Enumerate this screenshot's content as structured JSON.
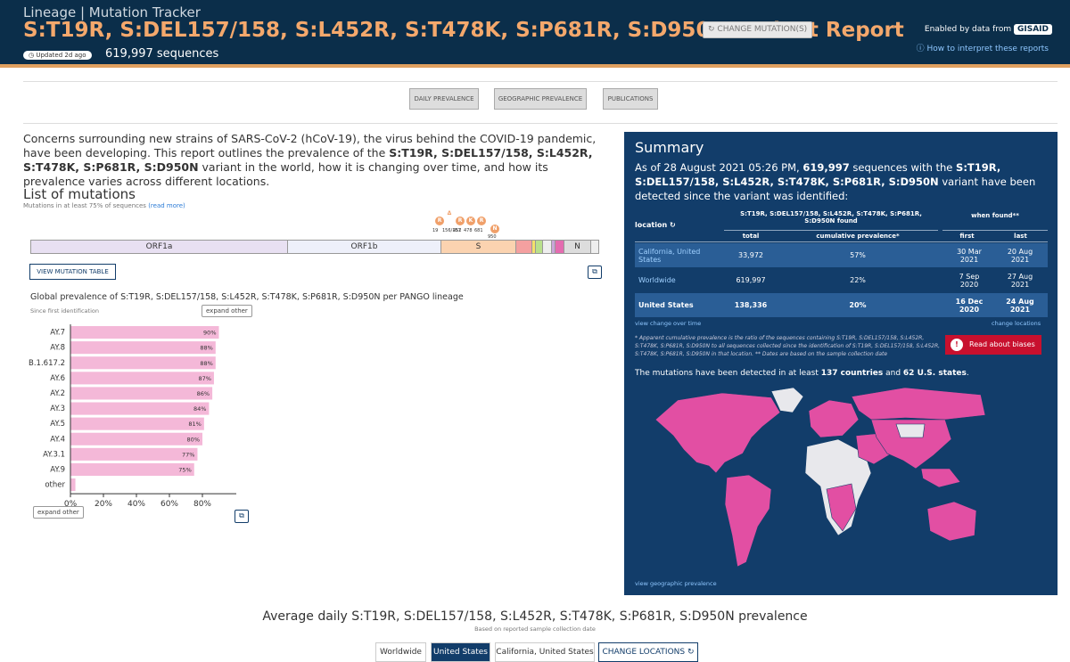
{
  "header": {
    "crumb": "Lineage | Mutation Tracker",
    "title": "S:T19R, S:DEL157/158, S:L452R, S:T478K, S:P681R, S:D950N Variant Report",
    "change_btn": "CHANGE MUTATION(S)",
    "updated": "Updated 2d ago",
    "sequences": "619,997 sequences",
    "enabled_by": "Enabled by data from",
    "gisaid": "GISAID",
    "howto": "How to interpret these reports"
  },
  "tabs": [
    "DAILY PREVALENCE",
    "GEOGRAPHIC PREVALENCE",
    "PUBLICATIONS"
  ],
  "intro": {
    "p1": "Concerns surrounding new strains of SARS-CoV-2 (hCoV-19), the virus behind the COVID-19 pandemic, have been developing. This report outlines the prevalence of the ",
    "bold": "S:T19R, S:DEL157/158, S:L452R, S:T478K, S:P681R, S:D950N",
    "p2": " variant in the world, how it is changing over time, and how its prevalence varies across different locations."
  },
  "mutations_section": {
    "title": "List of mutations",
    "subtitle": "Mutations in at least 75% of sequences ",
    "read_more": "(read more)",
    "view_table": "VIEW MUTATION TABLE"
  },
  "genome": {
    "segments": [
      "ORF1a",
      "ORF1b",
      "S",
      "N"
    ],
    "mut_markers": [
      "R",
      "Δ",
      "R",
      "K",
      "R",
      "N"
    ],
    "mut_labels": [
      "19",
      "156/157",
      "452",
      "478",
      "681",
      "950"
    ]
  },
  "lineage_chart": {
    "title": "Global prevalence of S:T19R, S:DEL157/158, S:L452R, S:T478K, S:P681R, S:D950N per PANGO lineage",
    "subtitle": "Since first identification",
    "expand_top": "expand other",
    "expand_bottom": "expand other"
  },
  "chart_data": {
    "type": "bar",
    "orientation": "horizontal",
    "categories": [
      "AY.7",
      "AY.8",
      "B.1.617.2",
      "AY.6",
      "AY.2",
      "AY.3",
      "AY.5",
      "AY.4",
      "AY.3.1",
      "AY.9",
      "other"
    ],
    "values": [
      90,
      88,
      88,
      87,
      86,
      84,
      81,
      80,
      77,
      75,
      3
    ],
    "labels": [
      "90%",
      "88%",
      "88%",
      "87%",
      "86%",
      "84%",
      "81%",
      "80%",
      "77%",
      "75%",
      ""
    ],
    "xticks": [
      "0%",
      "20%",
      "40%",
      "60%",
      "80%"
    ],
    "xlim": [
      0,
      100
    ],
    "color": "#f4b8d8"
  },
  "summary": {
    "title": "Summary",
    "text1": "As of 28 August 2021 05:26 PM, ",
    "count": "619,997",
    "text2": " sequences with the ",
    "bold": "S:T19R, S:DEL157/158, S:L452R, S:T478K, S:P681R, S:D950N",
    "text3": " variant have been detected since the variant was identified:",
    "table": {
      "loc_header": "location",
      "group_header": "S:T19R, S:DEL157/158, S:L452R, S:T478K, S:P681R, S:D950N found",
      "when_header": "when found**",
      "cols": [
        "total",
        "cumulative prevalence*",
        "first",
        "last"
      ],
      "rows": [
        {
          "loc": "California, United States",
          "total": "33,972",
          "prev": "57%",
          "first": "30 Mar 2021",
          "last": "20 Aug 2021"
        },
        {
          "loc": "Worldwide",
          "total": "619,997",
          "prev": "22%",
          "first": "7 Sep 2020",
          "last": "27 Aug 2021"
        },
        {
          "loc": "United States",
          "total": "138,336",
          "prev": "20%",
          "first": "16 Dec 2020",
          "last": "24 Aug 2021"
        }
      ]
    },
    "view_change": "view change over time",
    "change_locations": "change locations",
    "note": "* Apparent cumulative prevalence is the ratio of the sequences containing S:T19R, S:DEL157/158, S:L452R, S:T478K, S:P681R, S:D950N to all sequences collected since the identification of S:T19R, S:DEL157/158, S:L452R, S:T478K, S:P681R, S:D950N in that location.  ** Dates are based on the sample collection date",
    "bias": "Read about biases",
    "countries_pre": "The mutations have been detected in at least ",
    "countries": "137 countries",
    "and": " and ",
    "states": "62 U.S. states",
    "geo_link": "view geographic prevalence"
  },
  "bottom": {
    "title": "Average daily S:T19R, S:DEL157/158, S:L452R, S:T478K, S:P681R, S:D950N prevalence",
    "sub": "Based on reported sample collection date",
    "locs": [
      "Worldwide",
      "United States",
      "California, United States",
      "CHANGE LOCATIONS"
    ]
  },
  "colors": {
    "header": "#0b2e4a",
    "accent": "#f4a86c",
    "summary_bg": "#123d6a",
    "map_detected": "#e24fa3",
    "map_none": "#e8e8ec",
    "bias": "#c8102e"
  }
}
